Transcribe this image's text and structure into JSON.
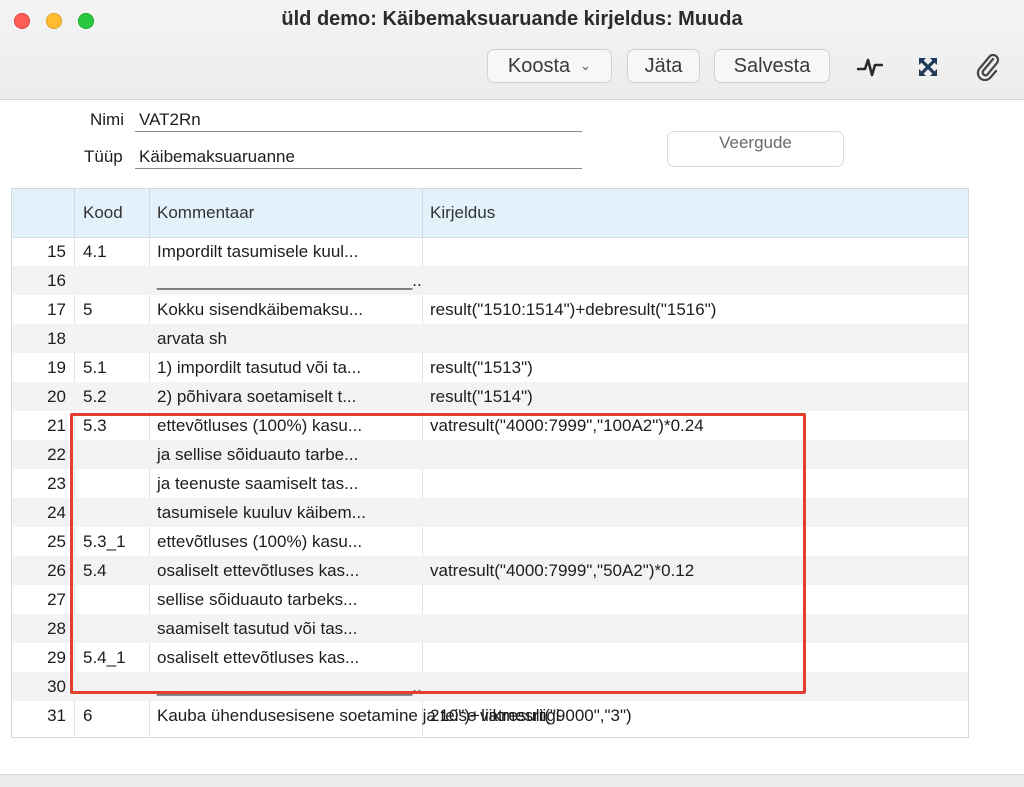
{
  "window": {
    "title": "üld demo: Käibemaksuaruande kirjeldus: Muuda"
  },
  "toolbar": {
    "koosta_label": "Koosta",
    "jata_label": "Jäta",
    "salvesta_label": "Salvesta"
  },
  "form": {
    "nimi_label": "Nimi",
    "nimi_value": "VAT2Rn",
    "tyyp_label": "Tüüp",
    "tyyp_value": "Käibemaksuaruanne",
    "veergude_label": "Veergude"
  },
  "table": {
    "headers": {
      "kood": "Kood",
      "kommentaar": "Kommentaar",
      "kirjeldus": "Kirjeldus"
    },
    "rows": [
      {
        "num": "15",
        "kood": "4.1",
        "kommentaar": "Impordilt tasumisele kuul...",
        "kirjeldus": ""
      },
      {
        "num": "16",
        "kood": "",
        "kommentaar": "___________________________...",
        "kirjeldus": ""
      },
      {
        "num": "17",
        "kood": "5",
        "kommentaar": "Kokku sisendkäibemaksu...",
        "kirjeldus": "result(\"1510:1514\")+debresult(\"1516\")"
      },
      {
        "num": "18",
        "kood": "",
        "kommentaar": "arvata sh",
        "kirjeldus": ""
      },
      {
        "num": "19",
        "kood": "5.1",
        "kommentaar": "1) impordilt tasutud või ta...",
        "kirjeldus": "result(\"1513\")"
      },
      {
        "num": "20",
        "kood": "5.2",
        "kommentaar": "2) põhivara soetamiselt t...",
        "kirjeldus": "result(\"1514\")"
      },
      {
        "num": "21",
        "kood": "5.3",
        "kommentaar": "ettevõtluses (100%) kasu...",
        "kirjeldus": "vatresult(\"4000:7999\",\"100A2\")*0.24"
      },
      {
        "num": "22",
        "kood": "",
        "kommentaar": "ja sellise sõiduauto tarbe...",
        "kirjeldus": ""
      },
      {
        "num": "23",
        "kood": "",
        "kommentaar": "ja teenuste saamiselt tas...",
        "kirjeldus": ""
      },
      {
        "num": "24",
        "kood": "",
        "kommentaar": "tasumisele kuuluv käibem...",
        "kirjeldus": ""
      },
      {
        "num": "25",
        "kood": "5.3_1",
        "kommentaar": "ettevõtluses (100%) kasu...",
        "kirjeldus": ""
      },
      {
        "num": "26",
        "kood": "5.4",
        "kommentaar": "osaliselt ettevõtluses kas...",
        "kirjeldus": "vatresult(\"4000:7999\",\"50A2\")*0.12"
      },
      {
        "num": "27",
        "kood": "",
        "kommentaar": "sellise sõiduauto tarbeks...",
        "kirjeldus": ""
      },
      {
        "num": "28",
        "kood": "",
        "kommentaar": "saamiselt  tasutud või tas...",
        "kirjeldus": ""
      },
      {
        "num": "29",
        "kood": "5.4_1",
        "kommentaar": "osaliselt ettevõtluses kas...",
        "kirjeldus": ""
      },
      {
        "num": "30",
        "kood": "",
        "kommentaar": "___________________________...",
        "kirjeldus": ""
      },
      {
        "num": "31",
        "kood": "6",
        "kommentaar": "Kauba ühendusesisene soetamine ja teise liikmesriigi",
        "kirjeldus": "210\")+vatresult(\"9000\",\"3\")"
      }
    ]
  },
  "colors": {
    "highlight": "#e0402f",
    "header_bg": "#e3f1fb"
  }
}
